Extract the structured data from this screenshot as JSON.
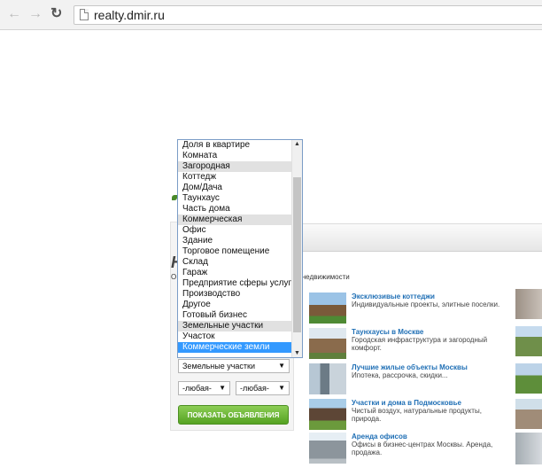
{
  "browser": {
    "back_icon": "arrow-left-icon",
    "forward_icon": "arrow-right-icon",
    "reload_icon": "reload-icon",
    "url": "realty.dmir.ru"
  },
  "page": {
    "heading_letter": "Н",
    "subtitle_fragment": "нде недвижимости",
    "subtitle_lead": "О"
  },
  "listbox": {
    "options": [
      "Доля в квартире",
      "Комната",
      "Загородная",
      "Коттедж",
      "Дом/Дача",
      "Таунхаус",
      "Часть дома",
      "Коммерческая",
      "Офис",
      "Здание",
      "Торговое помещение",
      "Склад",
      "Гараж",
      "Предприятие сферы услуг",
      "Производство",
      "Другое",
      "Готовый бизнес",
      "Земельные участки",
      "Участок",
      "Коммерческие земли"
    ]
  },
  "filters": {
    "type_select": "Земельные участки",
    "price_from": "-любая-",
    "price_to": "-любая-",
    "show_button": "ПОКАЗАТЬ ОБЪЯВЛЕНИЯ"
  },
  "offers": [
    {
      "title": "Эксклюзивые коттеджи",
      "text": "Индивидуальные проекты, элитные поселки."
    },
    {
      "title": "Таунхаусы в Москве",
      "text": "Городская инфраструктура и загородный комфорт."
    },
    {
      "title": "Лучшие жилые объекты Москвы",
      "text": "Ипотека, рассрочка, скидки..."
    },
    {
      "title": "Участки и дома в Подмосковье",
      "text": "Чистый воздух, натуральные продукты, природа."
    },
    {
      "title": "Аренда офисов",
      "text": "Офисы в бизнес-центрах Москвы. Аренда, продажа."
    }
  ]
}
